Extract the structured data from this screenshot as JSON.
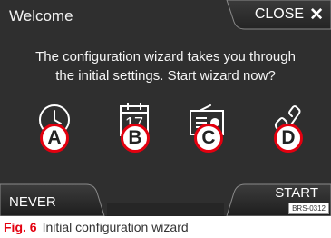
{
  "screen": {
    "title": "Welcome",
    "close_label": "CLOSE",
    "close_icon": "✕",
    "prompt_line1": "The configuration wizard takes you through",
    "prompt_line2": "the initial settings. Start wizard now?",
    "icons": [
      {
        "name": "clock-icon",
        "callout": "A"
      },
      {
        "name": "calendar-icon",
        "callout": "B",
        "calendar_day": "17"
      },
      {
        "name": "radio-icon",
        "callout": "C"
      },
      {
        "name": "phone-icon",
        "callout": "D"
      }
    ],
    "never_label": "NEVER",
    "start_label": "START",
    "ref_code": "BRS-0312"
  },
  "caption": {
    "fig_label": "Fig. 6",
    "text": "Initial configuration wizard"
  },
  "colors": {
    "screen_bg": "#2f2f2f",
    "accent_red": "#e3000f",
    "text": "#ffffff"
  }
}
